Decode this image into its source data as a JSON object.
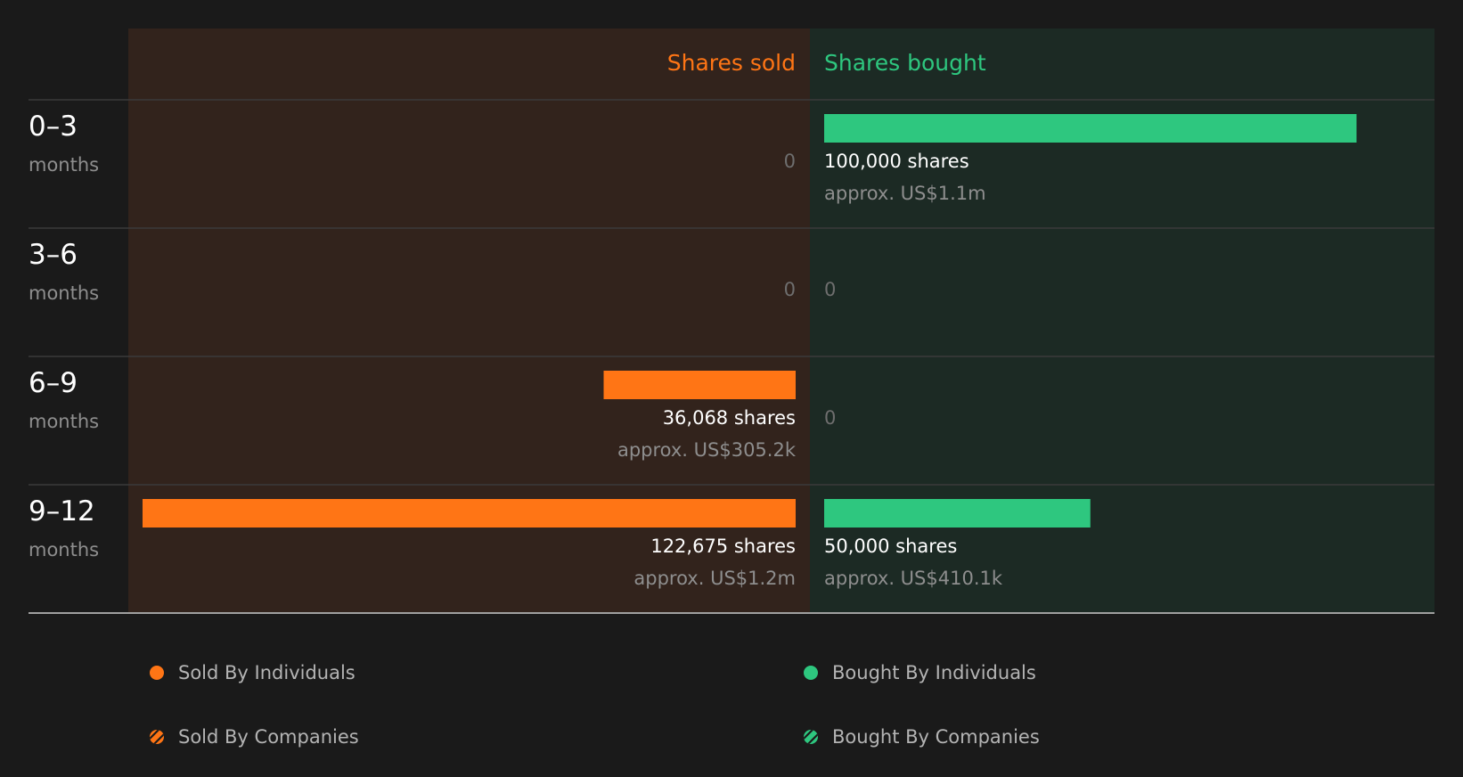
{
  "chart_data": {
    "type": "bar",
    "headers": {
      "sold": "Shares sold",
      "bought": "Shares bought"
    },
    "unit_suffix": " shares",
    "value_prefix": "approx. ",
    "max_shares": 122675,
    "rows": [
      {
        "range": "0–3",
        "unit": "months",
        "sold": {
          "shares": 0,
          "shares_label": "0",
          "value_label": ""
        },
        "bought": {
          "shares": 100000,
          "shares_label": "100,000 shares",
          "value_label": "approx. US$1.1m"
        }
      },
      {
        "range": "3–6",
        "unit": "months",
        "sold": {
          "shares": 0,
          "shares_label": "0",
          "value_label": ""
        },
        "bought": {
          "shares": 0,
          "shares_label": "0",
          "value_label": ""
        }
      },
      {
        "range": "6–9",
        "unit": "months",
        "sold": {
          "shares": 36068,
          "shares_label": "36,068 shares",
          "value_label": "approx. US$305.2k"
        },
        "bought": {
          "shares": 0,
          "shares_label": "0",
          "value_label": ""
        }
      },
      {
        "range": "9–12",
        "unit": "months",
        "sold": {
          "shares": 122675,
          "shares_label": "122,675 shares",
          "value_label": "approx. US$1.2m"
        },
        "bought": {
          "shares": 50000,
          "shares_label": "50,000 shares",
          "value_label": "approx. US$410.1k"
        }
      }
    ],
    "legend": [
      {
        "label": "Sold By Individuals",
        "marker": "dot",
        "color": "#ff7515"
      },
      {
        "label": "Bought By Individuals",
        "marker": "dot",
        "color": "#2ec77f"
      },
      {
        "label": "Sold By Companies",
        "marker": "hatched",
        "color": "#ff7515"
      },
      {
        "label": "Bought By Companies",
        "marker": "hatched",
        "color": "#2ec77f"
      }
    ]
  },
  "colors": {
    "background": "#1a1a1a",
    "sold_panel": "#32231c",
    "bought_panel": "#1c2a24",
    "sold": "#ff7515",
    "bought": "#2ec77f",
    "grid": "#3b3b3b",
    "baseline": "#a0a0a0",
    "text_primary": "#ffffff",
    "text_muted": "#8e8e8e",
    "text_zero": "#6e6e6e"
  }
}
